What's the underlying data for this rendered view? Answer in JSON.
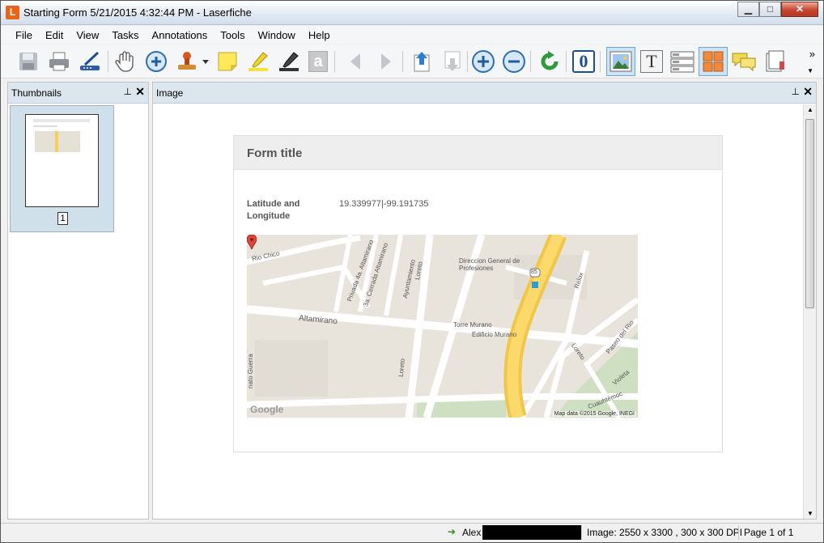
{
  "window": {
    "title": "Starting Form 5/21/2015 4:32:44 PM - Laserfiche",
    "app_icon_letter": "L",
    "minimize": "▁",
    "maximize": "□",
    "close": "✕"
  },
  "menu": [
    "File",
    "Edit",
    "View",
    "Tasks",
    "Annotations",
    "Tools",
    "Window",
    "Help"
  ],
  "toolbar": {
    "icons": [
      "save-icon",
      "print-icon",
      "scan-icon",
      "pan-hand-icon",
      "zoom-in-icon",
      "stamp-icon",
      "sticky-note-icon",
      "highlighter-icon",
      "marker-icon",
      "text-annotation-icon",
      "previous-page-icon",
      "next-page-icon",
      "previous-document-icon",
      "next-document-icon",
      "zoom-in-plus-icon",
      "zoom-out-minus-icon",
      "rotate-icon",
      "ocr-icon",
      "image-view-icon",
      "text-view-icon",
      "fields-view-icon",
      "thumbnails-view-icon",
      "annotations-pane-icon",
      "metadata-icon"
    ],
    "overflow": "»",
    "text_annotation_glyph": "a",
    "ocr_glyph": "0",
    "text_view_glyph": "T"
  },
  "thumbnails_pane": {
    "title": "Thumbnails",
    "pin": "⊥",
    "close": "✕",
    "page_number": "1"
  },
  "image_pane": {
    "title": "Image",
    "pin": "⊥",
    "close": "✕"
  },
  "form": {
    "title": "Form title",
    "field_label": "Latitude and Longitude",
    "field_value": "19.339977|-99.191735",
    "map": {
      "labels": [
        "Rio Chico",
        "Privada 4a. Altamirano",
        "3a. Cerrada Altamirano",
        "Ayuntamiento",
        "Loreto",
        "Direccion General de Profesiones",
        "Relox",
        "Altamirano",
        "Torre Murano",
        "Edificio Murano",
        "Loreto",
        "Paseo del Rio",
        "Violeta",
        "Cuauhtémoc",
        "Loreto",
        "Google",
        "nato Guerra"
      ],
      "route_number": "85",
      "attribution": "Map data ©2015 Google, INEGI"
    }
  },
  "statusbar": {
    "user": "Alex",
    "image_info": "Image: 2550 x 3300 , 300 x 300 DPI",
    "page_info": "Page 1 of 1"
  }
}
